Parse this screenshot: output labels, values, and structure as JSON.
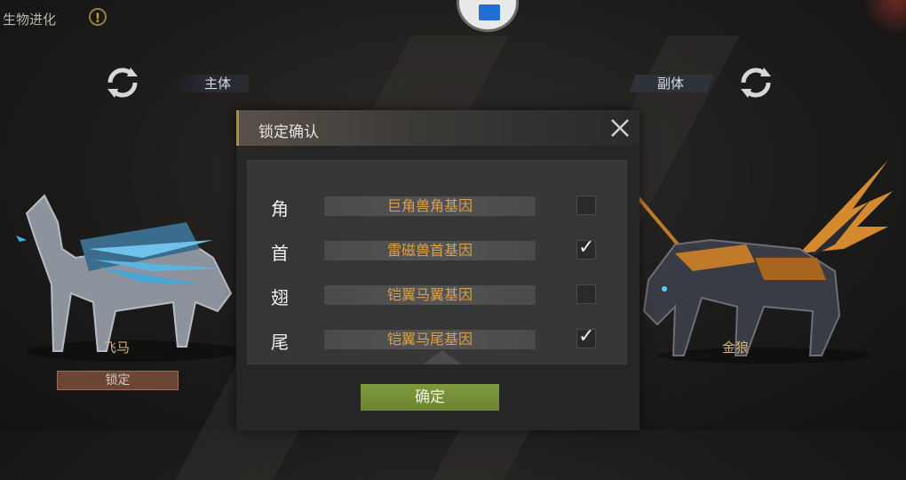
{
  "header": {
    "title": "生物进化",
    "warning_icon": "exclamation-circle-icon",
    "warning_glyph": "!"
  },
  "main_slot": {
    "label": "主体",
    "creature_name": "飞马",
    "lock_label": "锁定",
    "refresh_icon": "refresh-icon"
  },
  "sub_slot": {
    "label": "副体",
    "creature_name": "金狼",
    "refresh_icon": "refresh-icon"
  },
  "dialog": {
    "title": "锁定确认",
    "close_icon": "close-icon",
    "rows": [
      {
        "part": "角",
        "gene": "巨角兽角基因",
        "checked": false
      },
      {
        "part": "首",
        "gene": "雷磁兽首基因",
        "checked": true
      },
      {
        "part": "翅",
        "gene": "铠翼马翼基因",
        "checked": false
      },
      {
        "part": "尾",
        "gene": "铠翼马尾基因",
        "checked": true
      }
    ],
    "confirm_label": "确定"
  },
  "colors": {
    "accent_gold": "#d9a04b",
    "confirm_green": "#7f9a3d",
    "lock_brown": "#6b4536"
  }
}
